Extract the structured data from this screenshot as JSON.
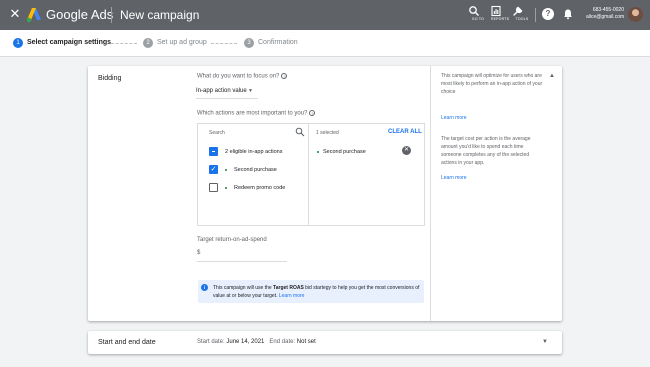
{
  "app": {
    "brand": "Google Ads",
    "campaign_title": "New campaign",
    "close_glyph": "✕"
  },
  "header": {
    "tools": [
      {
        "label": "GO TO",
        "icon": "search-icon"
      },
      {
        "label": "REPORTS",
        "icon": "reports-icon"
      },
      {
        "label": "TOOLS",
        "icon": "wrench-icon"
      }
    ],
    "account_phone": "683-455-0020",
    "account_email": "alice@gmail.com"
  },
  "stepper": {
    "steps": [
      {
        "number": "1",
        "label": "Select campaign settings",
        "state": "active"
      },
      {
        "number": "2",
        "label": "Set up ad group",
        "state": "inactive"
      },
      {
        "number": "3",
        "label": "Confirmation",
        "state": "inactive"
      }
    ]
  },
  "bidding": {
    "section_title": "Bidding",
    "focus_question": "What do you want to focus on?",
    "focus_value": "In-app action value",
    "actions_question": "Which actions are most important to you?",
    "search_placeholder": "Search",
    "eligible_row": "2 eligible in-app actions",
    "actions": [
      {
        "label": "Second purchase",
        "checked": true
      },
      {
        "label": "Redeem promo code",
        "checked": false
      }
    ],
    "selected_count": "1 selected",
    "clear_all": "CLEAR ALL",
    "selected_items": [
      "Second purchase"
    ],
    "roas_label": "Target return-on-ad-spend",
    "roas_value": "$",
    "info_text_1": "This campaign will use the ",
    "info_bold": "Target ROAS",
    "info_text_2": " bid startegy to help you get the most conversions of value at or below your target. ",
    "info_link": "Learn more"
  },
  "side_help": {
    "para1": "This campaign will optimize for users who are most likely to perform an in-app action of your choice",
    "link1": "Learn more",
    "para2": "The target cost per action is the average amount you'd like to spend each time someone completes any of the selected actions in your app.",
    "link2": "Learn more"
  },
  "dates": {
    "section_title": "Start and end date",
    "start_label": "Start date:",
    "start_value": "June 14, 2021",
    "end_label": "End date:",
    "end_value": "Not set"
  },
  "colors": {
    "topbar": "#5f6368",
    "accent": "#1a73e8",
    "action_dot": "#188038",
    "info_bg": "#e8f0fe"
  }
}
